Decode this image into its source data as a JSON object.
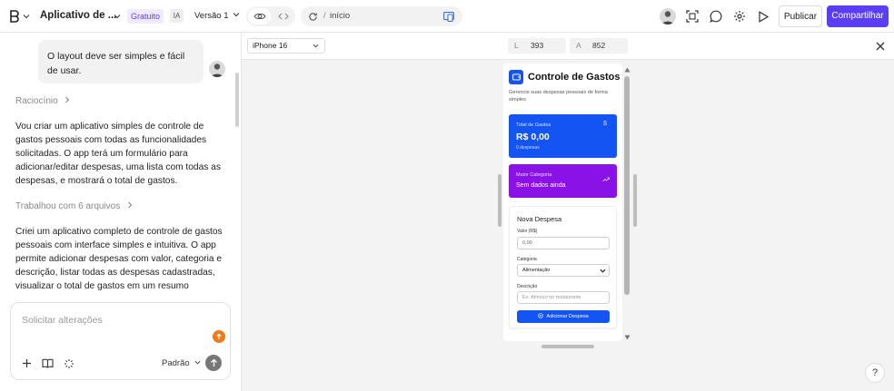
{
  "topbar": {
    "project_name": "Aplicativo de ...",
    "plan_badge": "Gratuito",
    "ai_badge": "IA",
    "version": "Versão 1",
    "route_slash": "/",
    "route": "início",
    "publish_label": "Publicar",
    "share_label": "Compartilhar"
  },
  "chat": {
    "user_message": "O layout deve ser simples e fácil de usar.",
    "reasoning_label": "Raciocínio",
    "assistant_intro": "Vou criar um aplicativo simples de controle de gastos pessoais com todas as funcionalidades solicitadas. O app terá um formulário para adicionar/editar despesas, uma lista com todas as despesas, e mostrará o total de gastos.",
    "files_label": "Trabalhou com 6 arquivos",
    "assistant_summary": "Criei um aplicativo completo de controle de gastos pessoais com interface simples e intuitiva. O app permite adicionar despesas com valor, categoria e descrição, listar todas as despesas cadastradas, visualizar o total de gastos em um resumo",
    "composer_placeholder": "Solicitar alterações",
    "mode_label": "Padrão"
  },
  "preview": {
    "device": "iPhone 16",
    "width_label": "L",
    "width_value": "393",
    "height_label": "A",
    "height_value": "852"
  },
  "app": {
    "title": "Controle de Gastos",
    "subtitle": "Gerencie suas despesas pessoais de forma simples",
    "total_label": "Total de Gastos",
    "total_value": "R$ 0,00",
    "total_count": "0 despesas",
    "currency_icon": "$",
    "top_category_label": "Maior Categoria",
    "top_category_value": "Sem dados ainda",
    "form_title": "Nova Despesa",
    "amount_label": "Valor (R$)",
    "amount_value": "0,00",
    "category_label": "Categoria",
    "category_value": "Alimentação",
    "description_label": "Descrição",
    "description_placeholder": "Ex: Almoço no restaurante",
    "submit_label": "Adicionar Despesa"
  },
  "colors": {
    "brand": "#5b3df5",
    "blue_card": "#1454f2",
    "purple_card": "#8a12e6",
    "submit": "#1454f2",
    "notify": "#f07a1c"
  }
}
